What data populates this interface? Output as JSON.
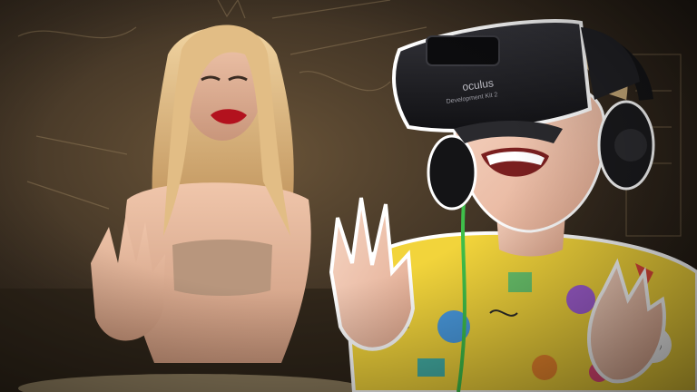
{
  "image": {
    "description_free": true,
    "headset": {
      "brand_text": "oculus",
      "model_text": "Development Kit 2",
      "color": "#1c1c1e"
    },
    "colors": {
      "background_dark": "#2a2218",
      "background_warm": "#5a4630",
      "hair": "#d9b07a",
      "lips": "#b3121e",
      "skin": "#e8b89c",
      "shirt_yellow": "#f2d43b",
      "cable_green": "#3fbf4a",
      "outline_white": "#ffffff"
    }
  }
}
